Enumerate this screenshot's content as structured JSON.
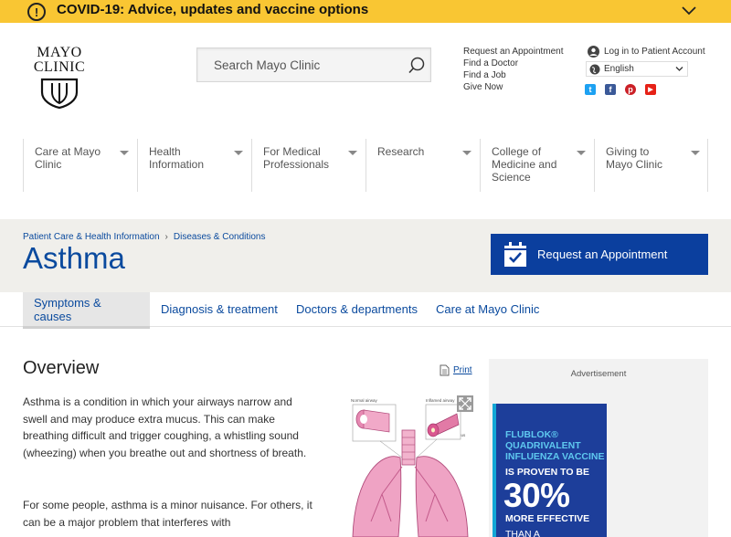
{
  "alert": {
    "icon_text": "!",
    "text": "COVID-19: Advice, updates and vaccine options"
  },
  "logo": {
    "line1": "MAYO",
    "line2": "CLINIC"
  },
  "search": {
    "placeholder": "Search Mayo Clinic"
  },
  "utility": {
    "links": [
      "Request an Appointment",
      "Find a Doctor",
      "Find a Job",
      "Give Now"
    ],
    "login_label": "Log in to Patient Account",
    "language": "English"
  },
  "social": {
    "twitter": "t",
    "facebook": "f",
    "pinterest": "p",
    "youtube": "▶"
  },
  "nav": {
    "items": [
      {
        "label": "Care at Mayo Clinic"
      },
      {
        "label": "Health Information"
      },
      {
        "label": "For Medical Professionals"
      },
      {
        "label": "Research"
      },
      {
        "label": "College of Medicine and Science"
      },
      {
        "label": "Giving to Mayo Clinic"
      }
    ]
  },
  "breadcrumb": {
    "items": [
      "Patient Care & Health Information",
      "Diseases & Conditions"
    ],
    "separator": "›"
  },
  "page": {
    "title": "Asthma",
    "appointment_label": "Request an Appointment"
  },
  "tabs": [
    {
      "label": "Symptoms & causes",
      "active": true
    },
    {
      "label": "Diagnosis & treatment",
      "active": false
    },
    {
      "label": "Doctors & departments",
      "active": false
    },
    {
      "label": "Care at Mayo Clinic",
      "active": false
    }
  ],
  "content": {
    "heading": "Overview",
    "print_label": "Print",
    "paragraphs": [
      "Asthma is a condition in which your airways narrow and swell and may produce extra mucus. This can make breathing difficult and trigger coughing, a whistling sound (wheezing) when you breathe out and shortness of breath.",
      "For some people, asthma is a minor nuisance. For others, it can be a major problem that interferes with"
    ],
    "illustration_labels": {
      "normal": "Normal airway",
      "inflamed": "Inflamed airway",
      "mucus": "Mucus"
    }
  },
  "ad": {
    "label": "Advertisement",
    "line_blue": "FLUBLOK® QUADRIVALENT INFLUENZA VACCINE",
    "line_white": "IS PROVEN TO BE",
    "big": "30%",
    "line_effective": "MORE EFFECTIVE",
    "line_than": "THAN A"
  },
  "colors": {
    "alert_bg": "#f9c633",
    "brand_blue": "#0a4a9e",
    "button_blue": "#0b3f9e",
    "ad_bg": "#1d3e9a",
    "ad_accent": "#5ec8ef"
  }
}
